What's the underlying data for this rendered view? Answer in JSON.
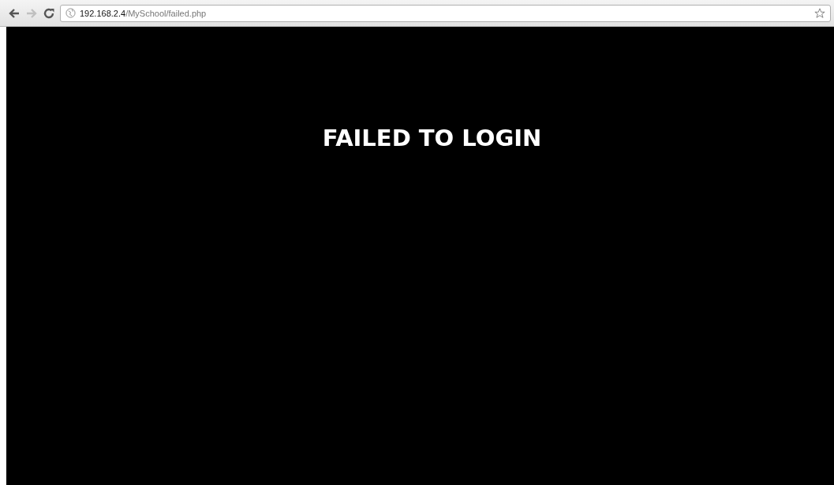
{
  "toolbar": {
    "address": {
      "host": "192.168.2.4",
      "path": "/MySchool/failed.php"
    },
    "back_disabled": false,
    "forward_disabled": true
  },
  "page": {
    "heading": "FAILED TO LOGIN"
  }
}
